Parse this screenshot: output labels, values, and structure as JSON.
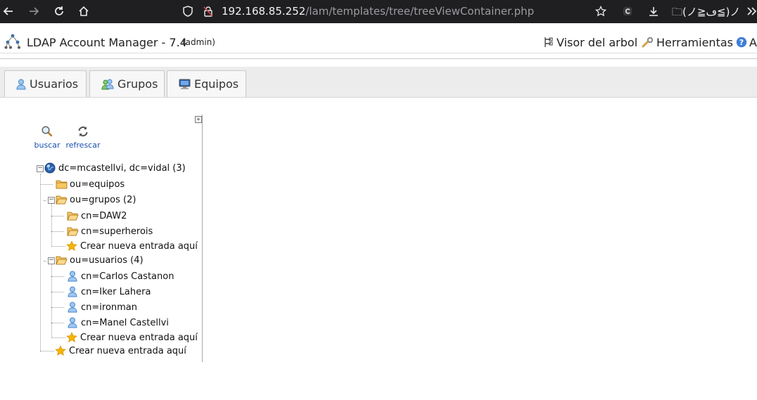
{
  "browser": {
    "url_host": "192.168.85.252",
    "url_path": "/lam/templates/tree/treeViewContainer.php",
    "bookmark_label": "(ノ≧ڡ≦)ノ"
  },
  "header": {
    "app_title": "LDAP Account Manager - 7.4",
    "user": "(admin)",
    "links": {
      "tree_view": "Visor del arbol",
      "tools": "Herramientas",
      "about": "A"
    }
  },
  "tabs": {
    "users": "Usuarios",
    "groups": "Grupos",
    "hosts": "Equipos"
  },
  "tree_tools": {
    "search": "buscar",
    "refresh": "refrescar",
    "expand_all": "+"
  },
  "tree": {
    "root": "dc=mcastellvi, dc=vidal (3)",
    "ou_equipos": "ou=equipos",
    "ou_grupos": "ou=grupos (2)",
    "grupos_children": [
      "cn=DAW2",
      "cn=superherois"
    ],
    "create_here": "Crear nueva entrada aquí",
    "ou_usuarios": "ou=usuarios (4)",
    "usuarios_children": [
      "cn=Carlos Castanon",
      "cn=Iker Lahera",
      "cn=ironman",
      "cn=Manel Castellvi"
    ]
  },
  "colors": {
    "browser_bg": "#1f1f22",
    "link_blue": "#1a4fb0",
    "folder": "#f0b030",
    "star": "#f5b400"
  }
}
